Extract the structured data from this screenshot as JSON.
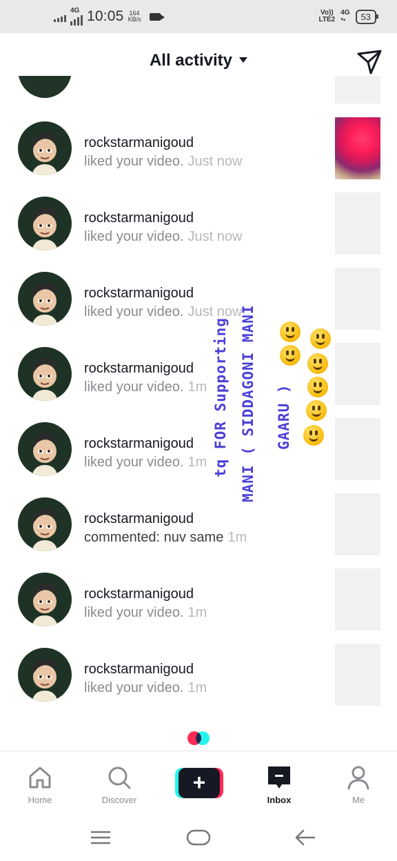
{
  "status_bar": {
    "network": "4G",
    "time": "10:05",
    "speed_value": "164",
    "speed_unit": "KB/s",
    "volte": "Vo))",
    "lte": "LTE2",
    "net2": "4G",
    "battery": "53"
  },
  "header": {
    "title": "All activity"
  },
  "notifications": [
    {
      "username": "rockstarmanigoud",
      "action": "liked your video.",
      "time": "Just now"
    },
    {
      "username": "rockstarmanigoud",
      "action": "liked your video.",
      "time": "Just now"
    },
    {
      "username": "rockstarmanigoud",
      "action": "liked your video.",
      "time": "Just now"
    },
    {
      "username": "rockstarmanigoud",
      "action": "liked your video.",
      "time": "1m"
    },
    {
      "username": "rockstarmanigoud",
      "action": "liked your video.",
      "time": "1m"
    },
    {
      "username": "rockstarmanigoud",
      "action": "commented: nuv same",
      "time": "1m"
    },
    {
      "username": "rockstarmanigoud",
      "action": "liked your video.",
      "time": "1m"
    },
    {
      "username": "rockstarmanigoud",
      "action": "liked your video.",
      "time": "1m"
    }
  ],
  "overlay": {
    "line1": "tq FOR Supporting",
    "line2": "MANI ( SIDDAGONI MANI",
    "line3": "GAARU )"
  },
  "bottom_nav": {
    "home": "Home",
    "discover": "Discover",
    "create": "+",
    "inbox": "Inbox",
    "me": "Me"
  },
  "icons": {
    "direct_message": "paper-plane-icon",
    "home": "house-icon",
    "discover": "search-icon",
    "inbox": "message-icon",
    "me": "person-icon"
  },
  "colors": {
    "accent_red": "#fe2c55",
    "accent_cyan": "#25f4ee",
    "overlay_text": "#4b3fd6"
  }
}
